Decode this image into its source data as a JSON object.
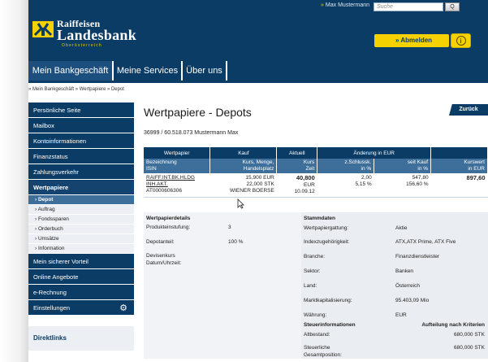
{
  "header": {
    "user": "Max Mustermann",
    "search_placeholder": "Suche",
    "search_button": "Q",
    "logo": {
      "line1": "Raiffeisen",
      "line2": "Landesbank",
      "line3": "Oberösterreich"
    },
    "logout_label": "Abmelden",
    "info_label": "i"
  },
  "nav": {
    "tabs": [
      "Mein Bankgeschäft",
      "Meine Services",
      "Über uns"
    ]
  },
  "breadcrumb": "» Mein Bankgeschäft » Wertpapiere » Depot",
  "sidebar": {
    "items": [
      "Persönliche Seite",
      "Mailbox",
      "Kontoinformationen",
      "Finanzstatus",
      "Zahlungsverkehr",
      "Wertpapiere"
    ],
    "sub_items": [
      "Depot",
      "Auftrag",
      "Fondssparen",
      "Orderbuch",
      "Umsätze",
      "Information"
    ],
    "items2": [
      "Mein sicherer Vorteil",
      "Online Angebote",
      "e-Rechnung",
      "Einstellungen"
    ],
    "direktlinks": "Direktlinks"
  },
  "main": {
    "title": "Wertpapiere - Depots",
    "back_label": "Zurück",
    "account": "36999 / 60.518.073 Mustermann Max"
  },
  "table": {
    "groups": [
      "Wertpapier",
      "Kauf",
      "Aktuell",
      "Änderung in EUR",
      ""
    ],
    "subheaders": [
      [
        "Bezeichnung",
        "ISIN"
      ],
      [
        "Kurs, Menge,",
        "Handelsplatz"
      ],
      [
        "Kurs",
        "Zeit"
      ],
      [
        "z.Schlussk.",
        "in %"
      ],
      [
        "seit Kauf",
        "in %"
      ],
      [
        "Kurswert",
        "in EUR"
      ]
    ],
    "row": {
      "name1": "RAIFF.INT.BK.HLDG",
      "name2": "INH.AKT.",
      "isin": "AT0000606306",
      "kurs": "15,900 EUR",
      "menge": "22,000 STK",
      "platz": "WIENER BOERSE",
      "aktuell": "40,800",
      "aktuell_cur": "EUR",
      "zeit": "10.09.12",
      "chg1": "2,00",
      "chg1_pct": "5,15 %",
      "chg2": "547,80",
      "chg2_pct": "156,60 %",
      "kurswert": "897,60"
    }
  },
  "details": {
    "heading": "Wertpapierdetails",
    "left": [
      {
        "label": "Produkteinstufung:",
        "value": "3"
      },
      {
        "label": "Depotanteil:",
        "value": "100 %"
      },
      {
        "label": "Devisenkurs",
        "value": ""
      },
      {
        "label": "Datum/Uhrzeit:",
        "value": ""
      }
    ],
    "stamm_heading": "Stammdaten",
    "right": [
      {
        "label": "Wertpapiergattung:",
        "value": "Aktie"
      },
      {
        "label": "Indexzugehörigkeit:",
        "value": "ATX,ATX Prime, ATX Five"
      },
      {
        "label": "Branche:",
        "value": "Finanzdienstleister"
      },
      {
        "label": "Sektor:",
        "value": "Banken"
      },
      {
        "label": "Land:",
        "value": "Österreich"
      },
      {
        "label": "Marktkapitalisierung:",
        "value": "95.403,09 Mio"
      },
      {
        "label": "Währung:",
        "value": "EUR"
      }
    ],
    "steuer_heading": "Steuerinformationen",
    "steuer_heading2": "Aufteilung nach Kriterien",
    "steuer": [
      {
        "label": "Altbestand:",
        "value": "680,000 STK"
      },
      {
        "label": "Steuerliche",
        "value": "680,000 STK"
      },
      {
        "label": "Gesamtposition:",
        "value": ""
      }
    ]
  },
  "colors": {
    "primary": "#0b3c66",
    "accent": "#f5d100",
    "sub_header": "#3e6f9b"
  }
}
